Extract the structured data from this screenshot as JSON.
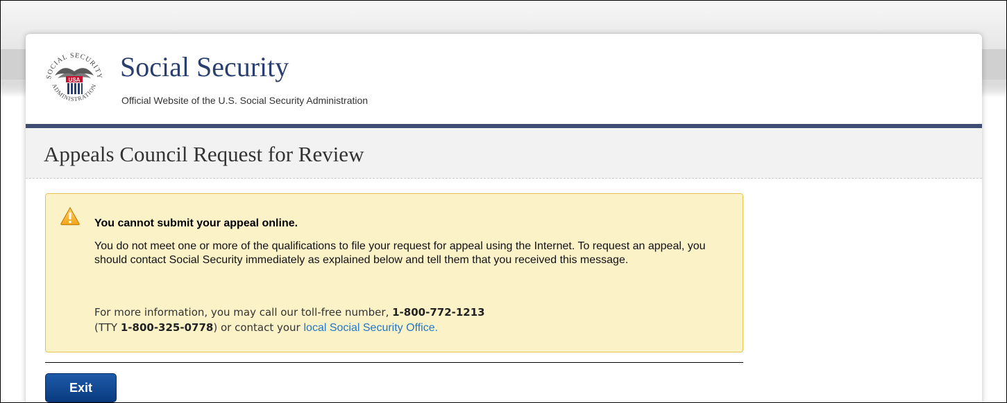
{
  "header": {
    "brand_title": "Social Security",
    "brand_subtitle": "Official Website of the U.S. Social Security Administration",
    "seal_text": "SOCIAL SECURITY ADMINISTRATION USA"
  },
  "page": {
    "title": "Appeals Council Request for Review"
  },
  "alert": {
    "icon": "warning-icon",
    "title": "You cannot submit your appeal online.",
    "body": "You do not meet one or more of the qualifications to file your request for appeal using the Internet. To request an appeal, you should contact Social Security immediately as explained below and tell them that you received this message.",
    "info_prefix": "For more information, you may call our toll-free number,",
    "phone": "1-800-772-1213",
    "tty_open": "(TTY",
    "tty_phone": "1-800-325-0778",
    "tty_close": ") or contact your",
    "office_link": "local Social Security Office."
  },
  "actions": {
    "exit_label": "Exit"
  },
  "colors": {
    "brand_navy": "#2a3f6e",
    "rule_navy": "#3f4d75",
    "alert_bg": "#fcf2c8",
    "alert_border": "#e6c34f",
    "button_blue": "#0a3b80",
    "link_blue": "#2176c7"
  }
}
